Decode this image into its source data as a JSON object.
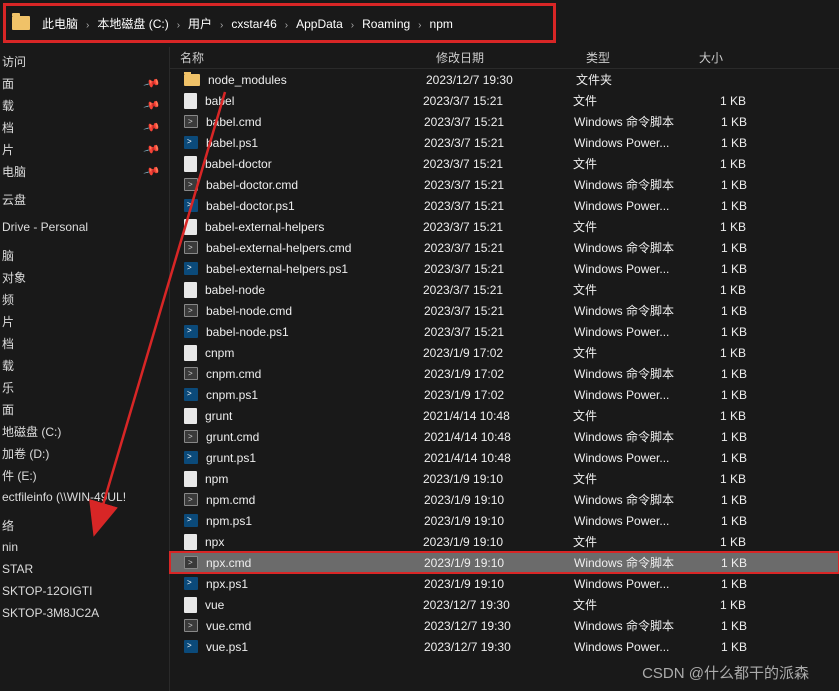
{
  "breadcrumb": [
    {
      "label": "此电脑"
    },
    {
      "label": "本地磁盘 (C:)"
    },
    {
      "label": "用户"
    },
    {
      "label": "cxstar46"
    },
    {
      "label": "AppData"
    },
    {
      "label": "Roaming"
    },
    {
      "label": "npm"
    }
  ],
  "columns": {
    "name": "名称",
    "date": "修改日期",
    "type": "类型",
    "size": "大小"
  },
  "sidebar": [
    {
      "label": "访问",
      "pin": false
    },
    {
      "label": "面",
      "pin": true
    },
    {
      "label": "载",
      "pin": true
    },
    {
      "label": "档",
      "pin": true
    },
    {
      "label": "片",
      "pin": true
    },
    {
      "label": "电脑",
      "pin": true
    },
    {
      "label": "",
      "spacer": true
    },
    {
      "label": "云盘",
      "pin": false
    },
    {
      "label": "",
      "spacer": true
    },
    {
      "label": "Drive - Personal",
      "pin": false
    },
    {
      "label": "",
      "spacer": true
    },
    {
      "label": "脑",
      "pin": false
    },
    {
      "label": "对象",
      "pin": false
    },
    {
      "label": "频",
      "pin": false
    },
    {
      "label": "片",
      "pin": false
    },
    {
      "label": "档",
      "pin": false
    },
    {
      "label": "载",
      "pin": false
    },
    {
      "label": "乐",
      "pin": false
    },
    {
      "label": "面",
      "pin": false
    },
    {
      "label": "地磁盘 (C:)",
      "pin": false
    },
    {
      "label": "加卷 (D:)",
      "pin": false
    },
    {
      "label": "件 (E:)",
      "pin": false
    },
    {
      "label": "ectfileinfo (\\\\WIN-49UL!",
      "pin": false
    },
    {
      "label": "",
      "spacer": true
    },
    {
      "label": "络",
      "pin": false
    },
    {
      "label": "nin",
      "pin": false
    },
    {
      "label": "STAR",
      "pin": false
    },
    {
      "label": "SKTOP-12OIGTI",
      "pin": false
    },
    {
      "label": "SKTOP-3M8JC2A",
      "pin": false
    }
  ],
  "files": [
    {
      "icon": "folder",
      "name": "node_modules",
      "date": "2023/12/7 19:30",
      "type": "文件夹",
      "size": ""
    },
    {
      "icon": "file",
      "name": "babel",
      "date": "2023/3/7 15:21",
      "type": "文件",
      "size": "1 KB"
    },
    {
      "icon": "cmd",
      "name": "babel.cmd",
      "date": "2023/3/7 15:21",
      "type": "Windows 命令脚本",
      "size": "1 KB"
    },
    {
      "icon": "ps1",
      "name": "babel.ps1",
      "date": "2023/3/7 15:21",
      "type": "Windows Power...",
      "size": "1 KB"
    },
    {
      "icon": "file",
      "name": "babel-doctor",
      "date": "2023/3/7 15:21",
      "type": "文件",
      "size": "1 KB"
    },
    {
      "icon": "cmd",
      "name": "babel-doctor.cmd",
      "date": "2023/3/7 15:21",
      "type": "Windows 命令脚本",
      "size": "1 KB"
    },
    {
      "icon": "ps1",
      "name": "babel-doctor.ps1",
      "date": "2023/3/7 15:21",
      "type": "Windows Power...",
      "size": "1 KB"
    },
    {
      "icon": "file",
      "name": "babel-external-helpers",
      "date": "2023/3/7 15:21",
      "type": "文件",
      "size": "1 KB"
    },
    {
      "icon": "cmd",
      "name": "babel-external-helpers.cmd",
      "date": "2023/3/7 15:21",
      "type": "Windows 命令脚本",
      "size": "1 KB"
    },
    {
      "icon": "ps1",
      "name": "babel-external-helpers.ps1",
      "date": "2023/3/7 15:21",
      "type": "Windows Power...",
      "size": "1 KB"
    },
    {
      "icon": "file",
      "name": "babel-node",
      "date": "2023/3/7 15:21",
      "type": "文件",
      "size": "1 KB"
    },
    {
      "icon": "cmd",
      "name": "babel-node.cmd",
      "date": "2023/3/7 15:21",
      "type": "Windows 命令脚本",
      "size": "1 KB"
    },
    {
      "icon": "ps1",
      "name": "babel-node.ps1",
      "date": "2023/3/7 15:21",
      "type": "Windows Power...",
      "size": "1 KB"
    },
    {
      "icon": "file",
      "name": "cnpm",
      "date": "2023/1/9 17:02",
      "type": "文件",
      "size": "1 KB"
    },
    {
      "icon": "cmd",
      "name": "cnpm.cmd",
      "date": "2023/1/9 17:02",
      "type": "Windows 命令脚本",
      "size": "1 KB"
    },
    {
      "icon": "ps1",
      "name": "cnpm.ps1",
      "date": "2023/1/9 17:02",
      "type": "Windows Power...",
      "size": "1 KB"
    },
    {
      "icon": "file",
      "name": "grunt",
      "date": "2021/4/14 10:48",
      "type": "文件",
      "size": "1 KB"
    },
    {
      "icon": "cmd",
      "name": "grunt.cmd",
      "date": "2021/4/14 10:48",
      "type": "Windows 命令脚本",
      "size": "1 KB"
    },
    {
      "icon": "ps1",
      "name": "grunt.ps1",
      "date": "2021/4/14 10:48",
      "type": "Windows Power...",
      "size": "1 KB"
    },
    {
      "icon": "file",
      "name": "npm",
      "date": "2023/1/9 19:10",
      "type": "文件",
      "size": "1 KB"
    },
    {
      "icon": "cmd",
      "name": "npm.cmd",
      "date": "2023/1/9 19:10",
      "type": "Windows 命令脚本",
      "size": "1 KB"
    },
    {
      "icon": "ps1",
      "name": "npm.ps1",
      "date": "2023/1/9 19:10",
      "type": "Windows Power...",
      "size": "1 KB"
    },
    {
      "icon": "file",
      "name": "npx",
      "date": "2023/1/9 19:10",
      "type": "文件",
      "size": "1 KB"
    },
    {
      "icon": "cmd",
      "name": "npx.cmd",
      "date": "2023/1/9 19:10",
      "type": "Windows 命令脚本",
      "size": "1 KB",
      "selected": true,
      "highlight": true
    },
    {
      "icon": "ps1",
      "name": "npx.ps1",
      "date": "2023/1/9 19:10",
      "type": "Windows Power...",
      "size": "1 KB"
    },
    {
      "icon": "file",
      "name": "vue",
      "date": "2023/12/7 19:30",
      "type": "文件",
      "size": "1 KB"
    },
    {
      "icon": "cmd",
      "name": "vue.cmd",
      "date": "2023/12/7 19:30",
      "type": "Windows 命令脚本",
      "size": "1 KB"
    },
    {
      "icon": "ps1",
      "name": "vue.ps1",
      "date": "2023/12/7 19:30",
      "type": "Windows Power...",
      "size": "1 KB"
    }
  ],
  "watermark": "CSDN @什么都干的派森"
}
